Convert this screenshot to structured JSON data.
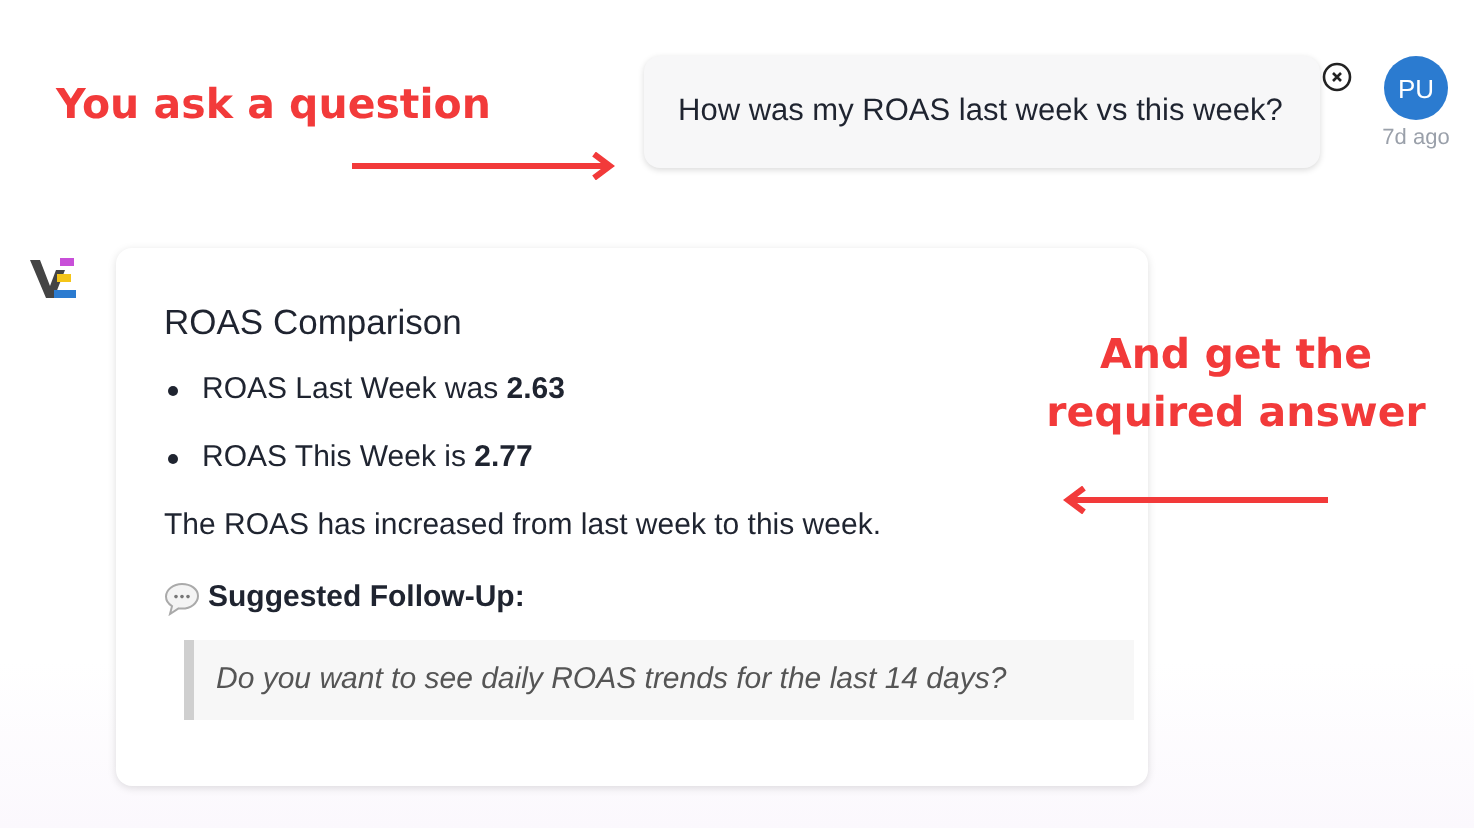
{
  "annotations": [
    {
      "text": "You ask a question",
      "kind": "right"
    },
    {
      "text": "And get the required answer",
      "kind": "left"
    }
  ],
  "user_message": {
    "text": "How was my ROAS last week vs this week?",
    "avatar": "PU",
    "time": "7d ago"
  },
  "response": {
    "title": "ROAS Comparison",
    "bullets": [
      "ROAS Last Week was **2.63**",
      "ROAS This Week is **2.77**"
    ],
    "summary": "The ROAS has increased from last week to this week.",
    "follow_up": {
      "heading": "Suggested Follow-Up:",
      "question": "Do you want to see daily ROAS trends for the last 14 days?"
    }
  }
}
